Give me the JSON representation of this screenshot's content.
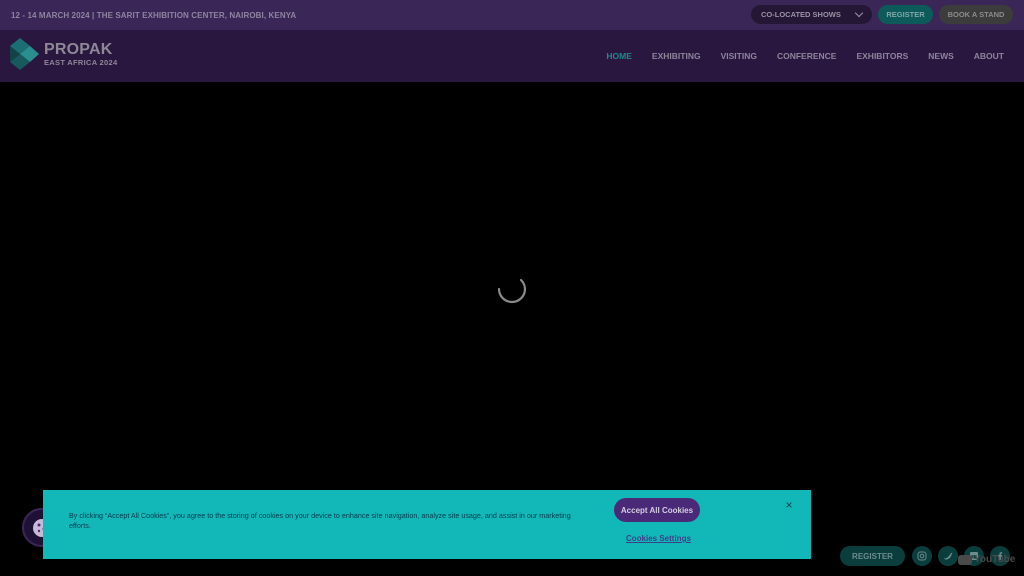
{
  "topbar": {
    "event_info": "12 - 14 MARCH 2024 | THE SARIT EXHIBITION CENTER, NAIROBI, KENYA",
    "colocated_label": "CO-LOCATED SHOWS",
    "register_label": "REGISTER",
    "book_stand_label": "BOOK A STAND"
  },
  "logo": {
    "main": "PROPAK",
    "sub": "EAST AFRICA 2024"
  },
  "nav": {
    "items": [
      {
        "label": "HOME",
        "active": true
      },
      {
        "label": "EXHIBITING"
      },
      {
        "label": "VISITING"
      },
      {
        "label": "CONFERENCE"
      },
      {
        "label": "EXHIBITORS"
      },
      {
        "label": "NEWS"
      },
      {
        "label": "ABOUT"
      }
    ]
  },
  "cookie_banner": {
    "text": "By clicking “Accept All Cookies”, you agree to the storing of cookies on your device to enhance site navigation, analyze site usage, and assist in our marketing efforts.",
    "accept_label": "Accept All Cookies",
    "settings_label": "Cookies Settings",
    "close_symbol": "×"
  },
  "footer": {
    "register_label": "REGISTER",
    "youtube_label": "YouTube",
    "social_icons": [
      "instagram-icon",
      "twitter-icon",
      "linkedin-icon",
      "facebook-icon"
    ]
  },
  "colors": {
    "topbar_bg": "#3a2757",
    "nav_bg": "#2a1740",
    "nav_active": "#1c8a8d",
    "cookie_bg": "#12b8b8",
    "accept_bg": "#4a2a78"
  }
}
